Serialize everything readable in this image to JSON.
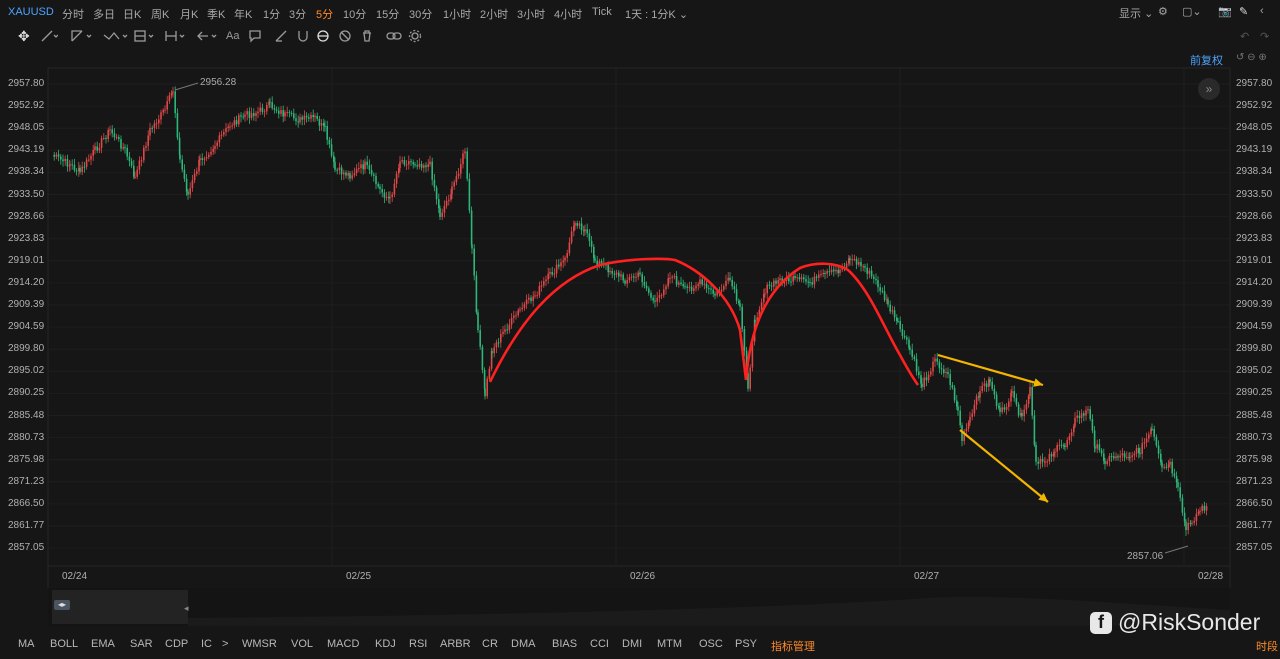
{
  "symbol": "XAUUSD",
  "timeframes": [
    "分时",
    "多日",
    "日K",
    "周K",
    "月K",
    "季K",
    "年K",
    "1分",
    "3分",
    "5分",
    "10分",
    "15分",
    "30分",
    "1小时",
    "2小时",
    "3小时",
    "4小时",
    "Tick"
  ],
  "active_timeframe_index": 9,
  "period_selector": "1天 : 1分K",
  "display_label": "显示",
  "adjust_label": "前复权",
  "y_ticks": [
    "2957.80",
    "2952.92",
    "2948.05",
    "2943.19",
    "2938.34",
    "2933.50",
    "2928.66",
    "2923.83",
    "2919.01",
    "2914.20",
    "2909.39",
    "2904.59",
    "2899.80",
    "2895.02",
    "2890.25",
    "2885.48",
    "2880.73",
    "2875.98",
    "2871.23",
    "2866.50",
    "2861.77",
    "2857.05"
  ],
  "x_ticks": [
    "02/24",
    "02/25",
    "02/26",
    "02/27",
    "02/28"
  ],
  "high_label": "2956.28",
  "low_label": "2857.06",
  "indicators": [
    "MA",
    "BOLL",
    "EMA",
    "SAR",
    "CDP",
    "IC",
    "WMSR",
    "VOL",
    "MACD",
    "KDJ",
    "RSI",
    "ARBR",
    "CR",
    "DMA",
    "BIAS",
    "CCI",
    "DMI",
    "MTM",
    "OSC",
    "PSY",
    "指标管理"
  ],
  "indicator_more": ">",
  "bottom_right": "时段",
  "watermark": "@RiskSonder",
  "tool_text": "Aa",
  "colors": {
    "up": "#e04848",
    "down": "#2db87a",
    "accent": "#ff8a2a",
    "link": "#4da3ff",
    "drawing_red": "#ff2020",
    "arrow": "#f4b400"
  }
}
